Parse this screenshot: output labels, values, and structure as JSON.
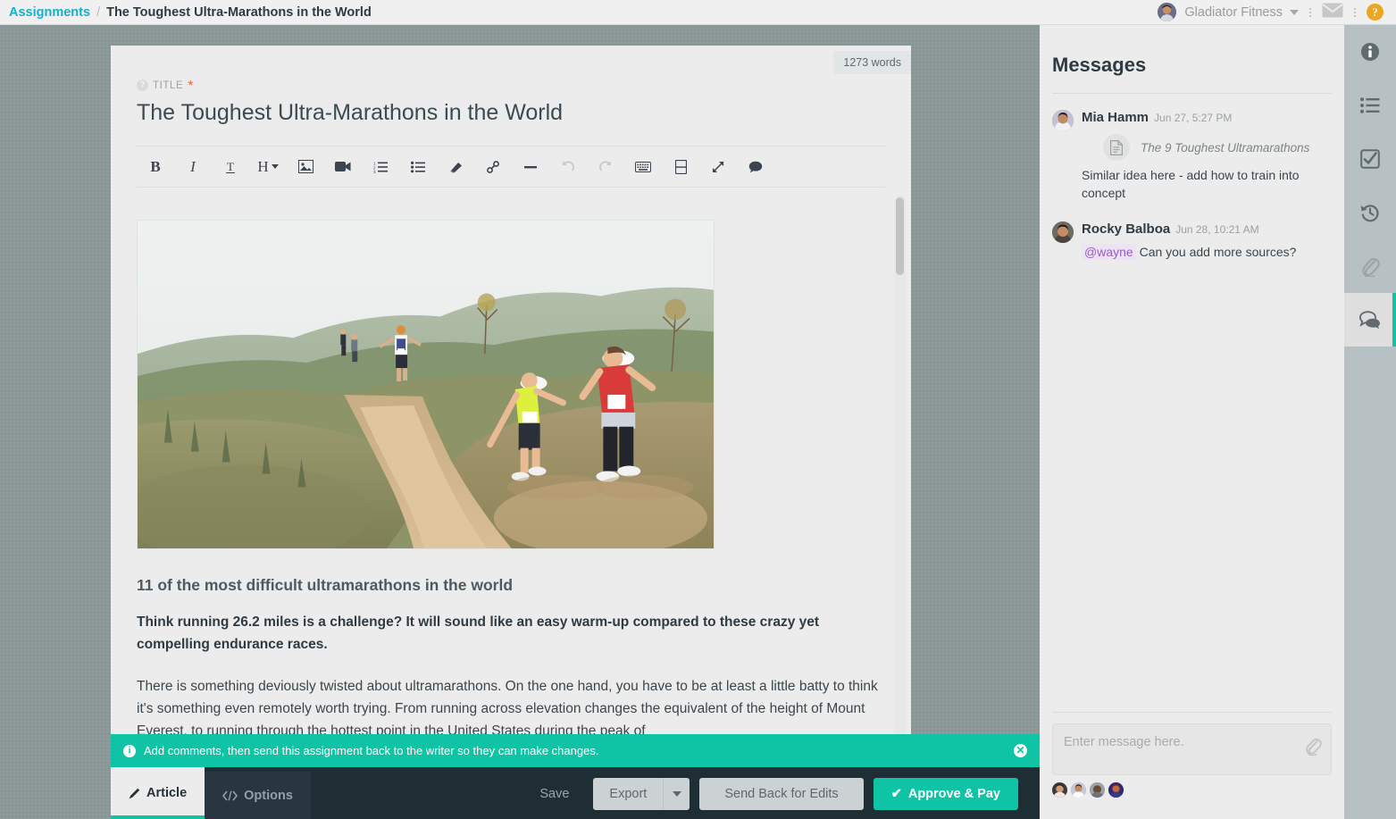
{
  "topbar": {
    "breadcrumb_root": "Assignments",
    "breadcrumb_sep": "/",
    "breadcrumb_current": "The Toughest Ultra-Marathons in the World",
    "account_name": "Gladiator Fitness",
    "help_glyph": "?",
    "icons": [
      "user-avatar",
      "chevron-down-icon",
      "envelope-icon",
      "help-icon"
    ]
  },
  "editor": {
    "word_count": "1273 words",
    "title_label": "TITLE",
    "title_required_marker": "*",
    "title_value": "The Toughest Ultra-Marathons in the World",
    "toolbar": [
      {
        "name": "bold-button",
        "label": "B",
        "disabled": false
      },
      {
        "name": "italic-button",
        "label": "I",
        "disabled": false
      },
      {
        "name": "text-style-button",
        "label": "T",
        "disabled": false
      },
      {
        "name": "heading-button",
        "label": "H",
        "disabled": false
      },
      {
        "name": "insert-image-button",
        "label": "image",
        "disabled": false
      },
      {
        "name": "insert-video-button",
        "label": "video",
        "disabled": false
      },
      {
        "name": "ordered-list-button",
        "label": "ordered-list",
        "disabled": false
      },
      {
        "name": "unordered-list-button",
        "label": "bullet-list",
        "disabled": false
      },
      {
        "name": "clear-format-button",
        "label": "eraser",
        "disabled": false
      },
      {
        "name": "insert-link-button",
        "label": "link",
        "disabled": false
      },
      {
        "name": "horizontal-rule-button",
        "label": "hr",
        "disabled": false
      },
      {
        "name": "undo-button",
        "label": "undo",
        "disabled": true
      },
      {
        "name": "redo-button",
        "label": "redo",
        "disabled": true
      },
      {
        "name": "keyboard-shortcuts-button",
        "label": "keyboard",
        "disabled": false
      },
      {
        "name": "page-break-button",
        "label": "page-break",
        "disabled": false
      },
      {
        "name": "fullscreen-button",
        "label": "expand",
        "disabled": false
      },
      {
        "name": "comment-button",
        "label": "comment",
        "disabled": false
      }
    ],
    "article": {
      "image_alt": "Trail runners climbing a dusty hillside path",
      "heading": "11 of the most difficult ultramarathons in the world",
      "lead": "Think running 26.2 miles is a challenge? It will sound like an easy warm-up compared to these crazy yet compelling endurance races.",
      "paragraph": "There is something deviously twisted about ultramarathons. On the one hand, you have to be at least a little batty to think it's something even remotely worth trying. From running across elevation changes the equivalent of the height of Mount Everest, to running through the hottest point in the United States during the peak of"
    }
  },
  "banner": {
    "icon": "info-icon",
    "message": "Add comments, then send this assignment back to the writer so they can make changes.",
    "close_glyph": "✕"
  },
  "bottombar": {
    "tabs": [
      {
        "name": "tab-article",
        "label": "Article",
        "icon": "pencil-icon",
        "active": true
      },
      {
        "name": "tab-options",
        "label": "Options",
        "icon": "code-icon",
        "active": false
      }
    ],
    "save_label": "Save",
    "export_label": "Export",
    "export_caret": "▼",
    "send_back_label": "Send Back for Edits",
    "approve_label": "Approve & Pay",
    "approve_check": "✔"
  },
  "messages": {
    "title": "Messages",
    "items": [
      {
        "author": "Mia Hamm",
        "time": "Jun 27, 5:27 PM",
        "attachment": "The 9 Toughest Ultramarathons",
        "text": "Similar idea here - add how to train into concept",
        "mention": null
      },
      {
        "author": "Rocky Balboa",
        "time": "Jun 28, 10:21 AM",
        "attachment": null,
        "mention": "@wayne",
        "text": "Can you add more sources?"
      }
    ],
    "compose_placeholder": "Enter message here.",
    "compose_value": "",
    "attach_icon": "paperclip-icon",
    "participant_count": 4
  },
  "rail": {
    "items": [
      {
        "name": "rail-info",
        "icon": "info-icon",
        "active": false
      },
      {
        "name": "rail-brief",
        "icon": "list-icon",
        "active": false
      },
      {
        "name": "rail-checklist",
        "icon": "checkbox-icon",
        "active": false
      },
      {
        "name": "rail-history",
        "icon": "history-icon",
        "active": false
      },
      {
        "name": "rail-attachments",
        "icon": "paperclip-icon",
        "active": false
      },
      {
        "name": "rail-messages",
        "icon": "comment-icon",
        "active": true
      }
    ]
  },
  "colors": {
    "accent_teal": "#0ec4a4",
    "link_blue": "#14b1cc",
    "dark_bar": "#1f2d35",
    "page_bg": "#8b9998",
    "help_orange": "#eda621",
    "required_red": "#e8603c",
    "mention_purple": "#9b5cc4"
  }
}
